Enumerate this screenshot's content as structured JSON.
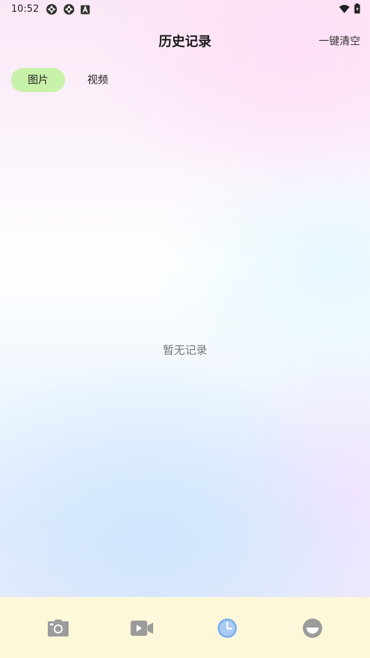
{
  "status_bar": {
    "time": "10:52",
    "left_icons": [
      "aperture-icon",
      "aperture-icon",
      "a-badge-icon"
    ],
    "right_icons": [
      "wifi-icon",
      "battery-icon"
    ]
  },
  "header": {
    "title": "历史记录",
    "clear_all_label": "一键清空"
  },
  "tabs": [
    {
      "label": "图片",
      "active": true
    },
    {
      "label": "视频",
      "active": false
    }
  ],
  "empty_state": {
    "text": "暂无记录"
  },
  "bottom_nav": {
    "items": [
      {
        "icon": "camera-icon",
        "active": false
      },
      {
        "icon": "video-camera-icon",
        "active": false
      },
      {
        "icon": "clock-icon",
        "active": true
      },
      {
        "icon": "profile-icon",
        "active": false
      }
    ]
  },
  "colors": {
    "tab_active_bg": "#c8f2a9",
    "bottom_nav_bg": "#fdf8d9",
    "nav_icon_inactive": "#9b9b9b",
    "nav_icon_active": "#7fb2ec"
  }
}
